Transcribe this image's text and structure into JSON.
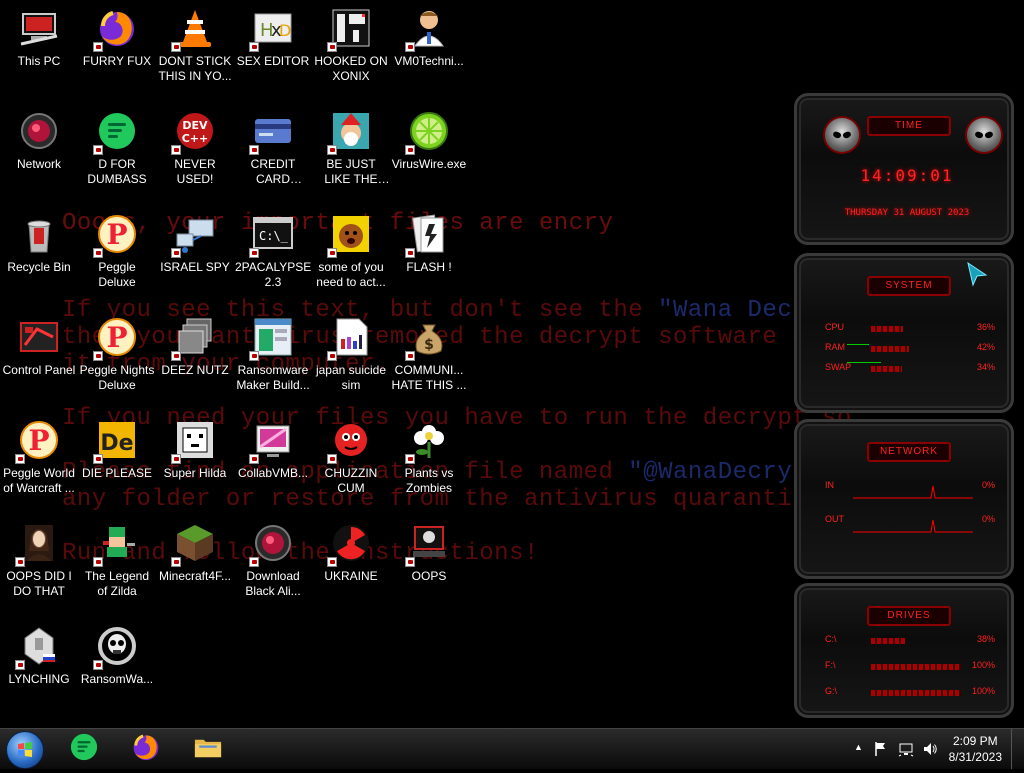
{
  "wallpaper": {
    "lines": [
      {
        "pre": "  Ooops, your important files are encry",
        "hl": "",
        "post": ""
      },
      {
        "pre": "If you see this text, but don't see the ",
        "hl": "\"Wana Decryp",
        "post": ""
      },
      {
        "pre": "then your antivirus removed the decrypt software or",
        "hl": "",
        "post": ""
      },
      {
        "pre": "it from your computer.",
        "hl": "",
        "post": ""
      },
      {
        "pre": "If you need your files you have to run the decrypt so",
        "hl": "",
        "post": ""
      },
      {
        "pre": "Please find an application file named ",
        "hl": "\"@WanaDecrypto",
        "post": ""
      },
      {
        "pre": "any folder or restore from the antivirus quarantine.",
        "hl": "",
        "post": ""
      },
      {
        "pre": "Run and follow the instructions!",
        "hl": "",
        "post": ""
      }
    ]
  },
  "desktop_icons": [
    {
      "label": "This PC",
      "icon": "computer-icon"
    },
    {
      "label": "FURRY FUX",
      "icon": "firefox-icon"
    },
    {
      "label": "DONT STICK THIS IN YO...",
      "icon": "vlc-cone-icon"
    },
    {
      "label": "SEX EDITOR",
      "icon": "hxd-editor-icon"
    },
    {
      "label": "HOOKED ON XONIX",
      "icon": "xonix-game-icon"
    },
    {
      "label": "VM0Techni...",
      "icon": "doctor-avatar-icon"
    },
    {
      "label": "Network",
      "icon": "alien-orb-icon"
    },
    {
      "label": "D FOR DUMBASS",
      "icon": "discord-green-icon"
    },
    {
      "label": "NEVER USED!",
      "icon": "devcpp-icon"
    },
    {
      "label": "CREDIT CARD CHECKER",
      "icon": "credit-card-icon"
    },
    {
      "label": "BE JUST LIKE THE DUDE!",
      "icon": "santa-elf-icon"
    },
    {
      "label": "VirusWire.exe",
      "icon": "lime-icon"
    },
    {
      "label": "Recycle Bin",
      "icon": "recycle-bin-icon"
    },
    {
      "label": "Peggle Deluxe",
      "icon": "peggle-icon"
    },
    {
      "label": "ISRAEL SPY",
      "icon": "network-spy-icon"
    },
    {
      "label": "2PACALYPSE 2.3",
      "icon": "terminal-icon"
    },
    {
      "label": "some of you need to act...",
      "icon": "dog-cartoon-icon"
    },
    {
      "label": "FLASH !",
      "icon": "flash-card-icon"
    },
    {
      "label": "Control Panel",
      "icon": "control-panel-icon"
    },
    {
      "label": "Peggle Nights Deluxe",
      "icon": "peggle-icon"
    },
    {
      "label": "DEEZ NUTZ",
      "icon": "stacked-windows-icon"
    },
    {
      "label": "Ransomware Maker Build...",
      "icon": "app-window-icon"
    },
    {
      "label": "japan suicide sim",
      "icon": "document-icon"
    },
    {
      "label": "COMMUNI... HATE THIS ...",
      "icon": "money-bag-icon"
    },
    {
      "label": "Peggle World of Warcraft ...",
      "icon": "peggle-icon"
    },
    {
      "label": "DIE PLEASE",
      "icon": "de-icon"
    },
    {
      "label": "Super Hilda",
      "icon": "pixel-dog-icon"
    },
    {
      "label": "CollabVMB...",
      "icon": "collab-vm-icon"
    },
    {
      "label": "CHUZZIN CUM",
      "icon": "chuzzle-icon"
    },
    {
      "label": "Plants vs Zombies",
      "icon": "flower-icon"
    },
    {
      "label": "OOPS DID I DO THAT",
      "icon": "portrait-icon"
    },
    {
      "label": "The Legend of Zilda",
      "icon": "pixel-hero-icon"
    },
    {
      "label": "Minecraft4F...",
      "icon": "grass-block-icon"
    },
    {
      "label": "Download Black Ali...",
      "icon": "alien-orb-icon"
    },
    {
      "label": "UKRAINE",
      "icon": "radiation-icon"
    },
    {
      "label": "OOPS",
      "icon": "skull-laptop-icon"
    },
    {
      "label": "LYNCHING",
      "icon": "lynch-icon"
    },
    {
      "label": "RansomWa...",
      "icon": "skull-ring-icon"
    }
  ],
  "gadgets": {
    "time": {
      "title": "TIME",
      "clock": "14:09:01",
      "date": "THURSDAY 31 AUGUST 2023"
    },
    "system": {
      "title": "SYSTEM",
      "rows": [
        {
          "name": "CPU",
          "pct": "36%",
          "value": 0.36
        },
        {
          "name": "RAM",
          "pct": "42%",
          "value": 0.42
        },
        {
          "name": "SWAP",
          "pct": "34%",
          "value": 0.34
        }
      ]
    },
    "network": {
      "title": "NETWORK",
      "rows": [
        {
          "name": "IN",
          "pct": "0%"
        },
        {
          "name": "OUT",
          "pct": "0%"
        }
      ]
    },
    "drives": {
      "title": "DRIVES",
      "rows": [
        {
          "name": "C:\\",
          "pct": "38%",
          "value": 0.38
        },
        {
          "name": "F:\\",
          "pct": "100%",
          "value": 1.0
        },
        {
          "name": "G:\\",
          "pct": "100%",
          "value": 1.0
        }
      ]
    }
  },
  "taskbar": {
    "pinned": [
      {
        "name": "discord-pinned",
        "icon": "discord-green-icon"
      },
      {
        "name": "firefox-pinned",
        "icon": "firefox-icon"
      },
      {
        "name": "explorer-pinned",
        "icon": "folder-icon"
      }
    ],
    "clock_time": "2:09 PM",
    "clock_date": "8/31/2023"
  }
}
